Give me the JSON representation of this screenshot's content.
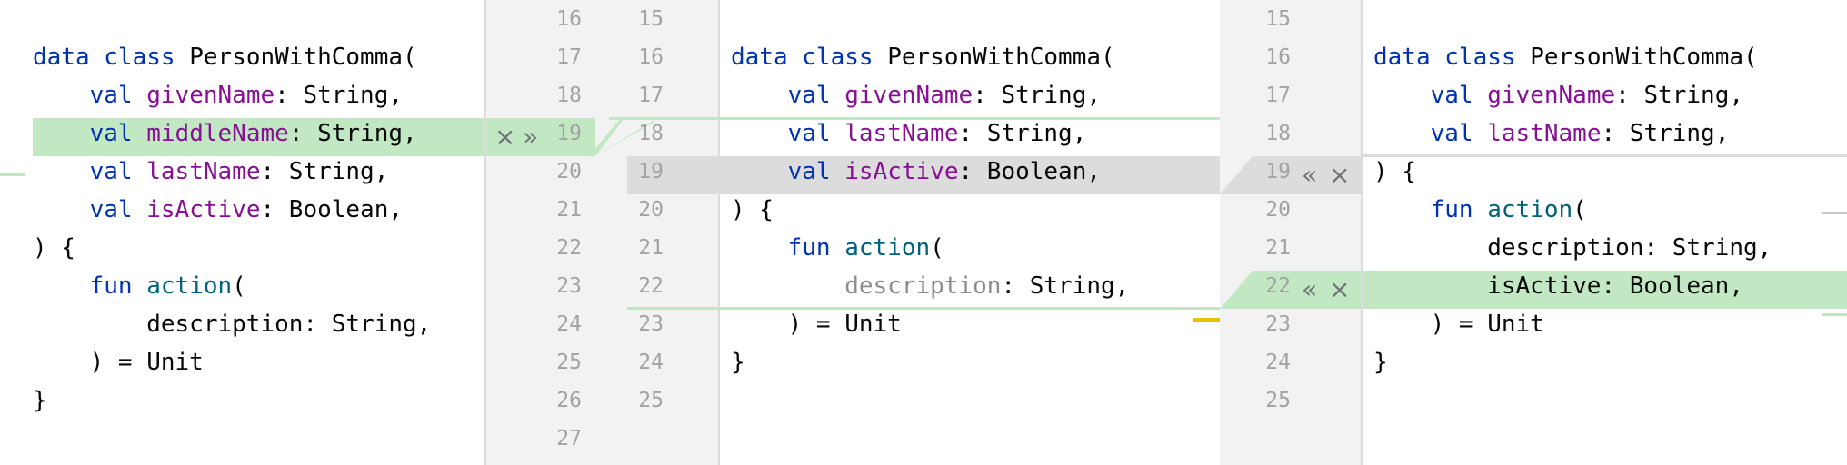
{
  "left": {
    "line_numbers": [
      "16",
      "17",
      "18",
      "19",
      "20",
      "21",
      "22",
      "23",
      "24",
      "25",
      "26",
      "27"
    ],
    "code": [
      {
        "parts": []
      },
      {
        "parts": [
          {
            "t": "data",
            "c": "kw"
          },
          {
            "t": " "
          },
          {
            "t": "class",
            "c": "kw"
          },
          {
            "t": " PersonWithComma("
          }
        ]
      },
      {
        "parts": [
          {
            "t": "    "
          },
          {
            "t": "val",
            "c": "kw"
          },
          {
            "t": " "
          },
          {
            "t": "givenName",
            "c": "prop"
          },
          {
            "t": ": String,"
          }
        ]
      },
      {
        "parts": [
          {
            "t": "    "
          },
          {
            "t": "val",
            "c": "kw"
          },
          {
            "t": " "
          },
          {
            "t": "middleName",
            "c": "prop"
          },
          {
            "t": ": String,"
          }
        ]
      },
      {
        "parts": [
          {
            "t": "    "
          },
          {
            "t": "val",
            "c": "kw"
          },
          {
            "t": " "
          },
          {
            "t": "lastName",
            "c": "prop"
          },
          {
            "t": ": String,"
          }
        ]
      },
      {
        "parts": [
          {
            "t": "    "
          },
          {
            "t": "val",
            "c": "kw"
          },
          {
            "t": " "
          },
          {
            "t": "isActive",
            "c": "prop"
          },
          {
            "t": ": Boolean,"
          }
        ]
      },
      {
        "parts": [
          {
            "t": ") {"
          }
        ]
      },
      {
        "parts": [
          {
            "t": "    "
          },
          {
            "t": "fun",
            "c": "kw"
          },
          {
            "t": " "
          },
          {
            "t": "action",
            "c": "fn"
          },
          {
            "t": "("
          }
        ]
      },
      {
        "parts": [
          {
            "t": "        description: String,"
          }
        ]
      },
      {
        "parts": [
          {
            "t": "    ) = Unit"
          }
        ]
      },
      {
        "parts": [
          {
            "t": "}"
          }
        ]
      },
      {
        "parts": []
      }
    ],
    "actions": {
      "reject": "×",
      "apply": "»"
    }
  },
  "center": {
    "line_numbers": [
      "15",
      "16",
      "17",
      "18",
      "19",
      "20",
      "21",
      "22",
      "23",
      "24",
      "25"
    ],
    "code": [
      {
        "parts": []
      },
      {
        "parts": [
          {
            "t": "data",
            "c": "kw"
          },
          {
            "t": " "
          },
          {
            "t": "class",
            "c": "kw"
          },
          {
            "t": " PersonWithComma("
          }
        ]
      },
      {
        "parts": [
          {
            "t": "    "
          },
          {
            "t": "val",
            "c": "kw"
          },
          {
            "t": " "
          },
          {
            "t": "givenName",
            "c": "prop"
          },
          {
            "t": ": String,"
          }
        ]
      },
      {
        "parts": [
          {
            "t": "    "
          },
          {
            "t": "val",
            "c": "kw"
          },
          {
            "t": " "
          },
          {
            "t": "lastName",
            "c": "prop"
          },
          {
            "t": ": String,"
          }
        ]
      },
      {
        "parts": [
          {
            "t": "    "
          },
          {
            "t": "val",
            "c": "kw"
          },
          {
            "t": " "
          },
          {
            "t": "isActive",
            "c": "prop"
          },
          {
            "t": ": Boolean,"
          }
        ]
      },
      {
        "parts": [
          {
            "t": ") {"
          }
        ]
      },
      {
        "parts": [
          {
            "t": "    "
          },
          {
            "t": "fun",
            "c": "kw"
          },
          {
            "t": " "
          },
          {
            "t": "action",
            "c": "fn"
          },
          {
            "t": "("
          }
        ]
      },
      {
        "parts": [
          {
            "t": "        "
          },
          {
            "t": "description",
            "c": "faded"
          },
          {
            "t": ": String,"
          }
        ]
      },
      {
        "parts": [
          {
            "t": "    ) = Unit"
          }
        ]
      },
      {
        "parts": [
          {
            "t": "}"
          }
        ]
      },
      {
        "parts": []
      }
    ]
  },
  "right": {
    "line_numbers": [
      "15",
      "16",
      "17",
      "18",
      "19",
      "20",
      "21",
      "22",
      "23",
      "24",
      "25"
    ],
    "code": [
      {
        "parts": []
      },
      {
        "parts": [
          {
            "t": "data",
            "c": "kw"
          },
          {
            "t": " "
          },
          {
            "t": "class",
            "c": "kw"
          },
          {
            "t": " PersonWithComma("
          }
        ]
      },
      {
        "parts": [
          {
            "t": "    "
          },
          {
            "t": "val",
            "c": "kw"
          },
          {
            "t": " "
          },
          {
            "t": "givenName",
            "c": "prop"
          },
          {
            "t": ": String,"
          }
        ]
      },
      {
        "parts": [
          {
            "t": "    "
          },
          {
            "t": "val",
            "c": "kw"
          },
          {
            "t": " "
          },
          {
            "t": "lastName",
            "c": "prop"
          },
          {
            "t": ": String,"
          }
        ]
      },
      {
        "parts": [
          {
            "t": ") {"
          }
        ]
      },
      {
        "parts": [
          {
            "t": "    "
          },
          {
            "t": "fun",
            "c": "kw"
          },
          {
            "t": " "
          },
          {
            "t": "action",
            "c": "fn"
          },
          {
            "t": "("
          }
        ]
      },
      {
        "parts": [
          {
            "t": "        description: String,"
          }
        ]
      },
      {
        "parts": [
          {
            "t": "        isActive: Boolean,"
          }
        ]
      },
      {
        "parts": [
          {
            "t": "    ) = Unit"
          }
        ]
      },
      {
        "parts": [
          {
            "t": "}"
          }
        ]
      },
      {
        "parts": []
      }
    ],
    "actions": {
      "apply": "«",
      "reject": "×"
    }
  },
  "colors": {
    "keyword": "#0033b3",
    "property": "#871094",
    "function": "#00627a",
    "added_bg": "#c1e8c2",
    "changed_bg": "#dcdcdc",
    "gutter_bg": "#f2f2f2",
    "marker_yellow": "#e6c200"
  }
}
